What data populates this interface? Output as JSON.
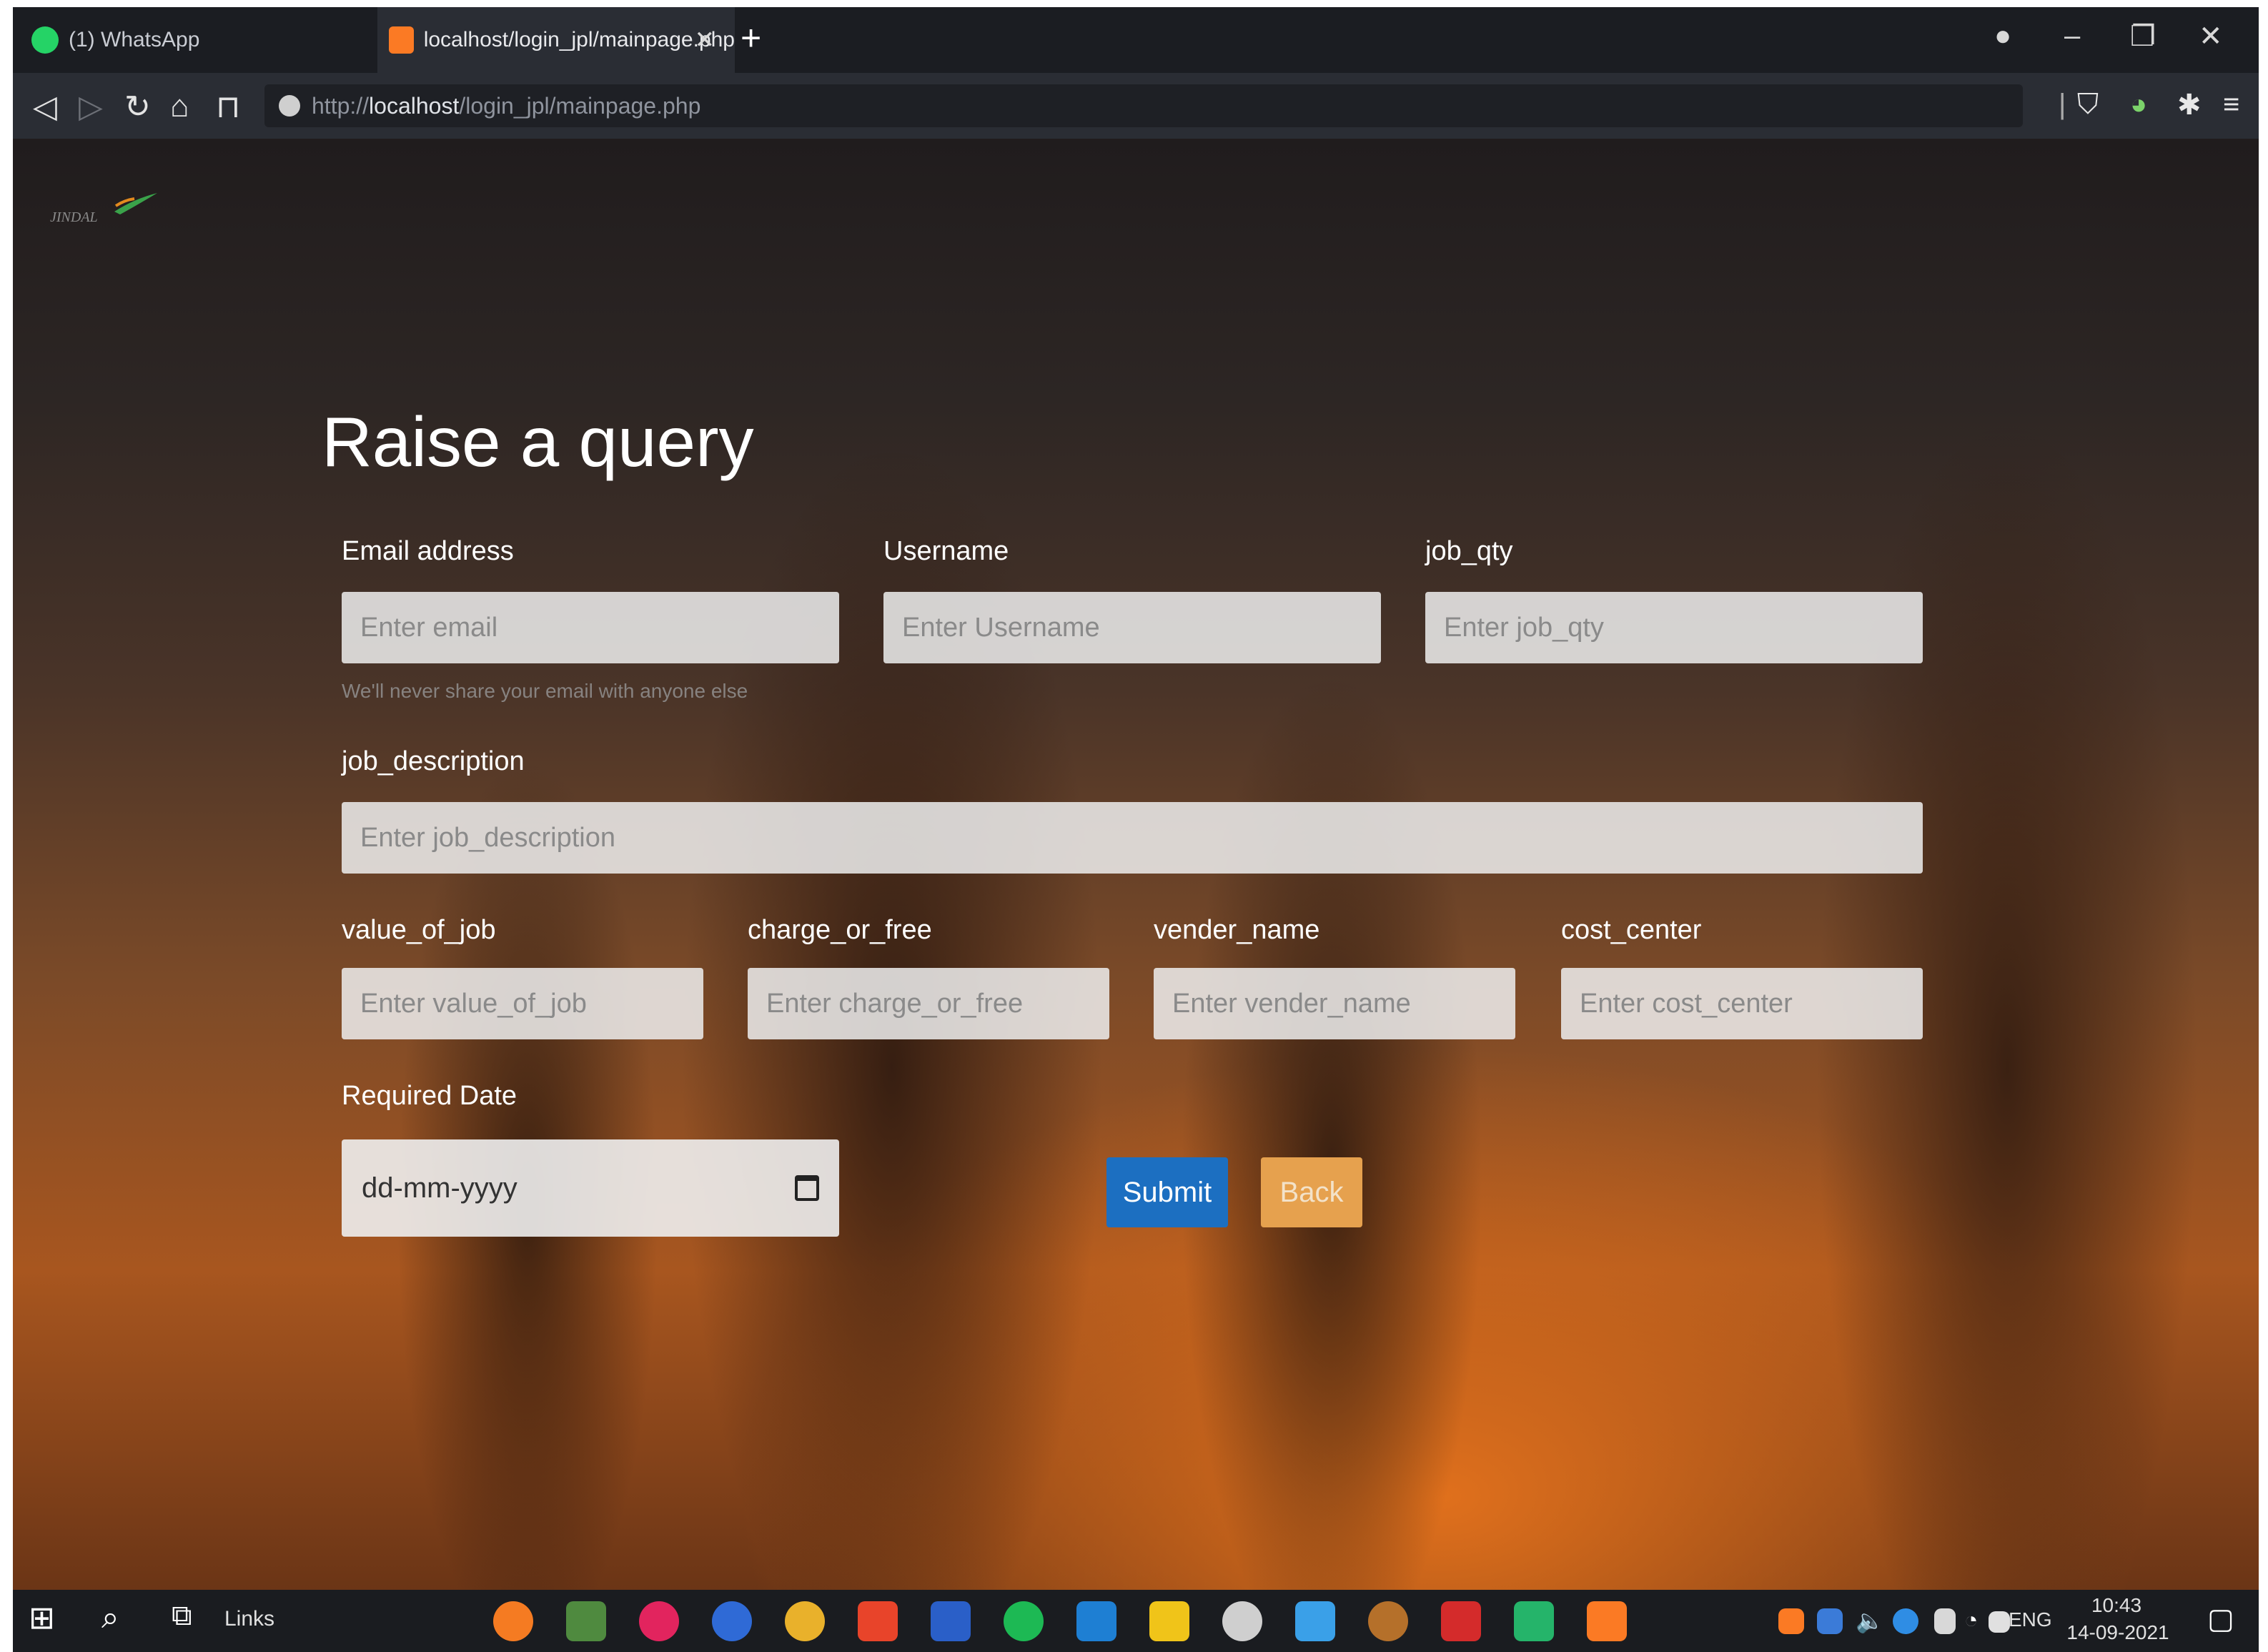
{
  "browser": {
    "tabs": [
      {
        "label": "(1) WhatsApp"
      },
      {
        "label": "localhost/login_jpl/mainpage.php"
      }
    ],
    "tab_close": "✕",
    "new_tab": "+",
    "url_prefix": "http://",
    "url_host": "localhost",
    "url_path": "/login_jpl/mainpage.php"
  },
  "page": {
    "logo_text": "JINDAL",
    "title": "Raise a query",
    "fields": {
      "email": {
        "label": "Email address",
        "placeholder": "Enter email",
        "help": "We'll never share your email with anyone else"
      },
      "username": {
        "label": "Username",
        "placeholder": "Enter Username"
      },
      "job_qty": {
        "label": "job_qty",
        "placeholder": "Enter job_qty"
      },
      "job_description": {
        "label": "job_description",
        "placeholder": "Enter job_description"
      },
      "value_of_job": {
        "label": "value_of_job",
        "placeholder": "Enter value_of_job"
      },
      "charge_or_free": {
        "label": "charge_or_free",
        "placeholder": "Enter charge_or_free"
      },
      "vender_name": {
        "label": "vender_name",
        "placeholder": "Enter vender_name"
      },
      "cost_center": {
        "label": "cost_center",
        "placeholder": "Enter cost_center"
      },
      "required_date": {
        "label": "Required Date",
        "placeholder": "dd-mm-yyyy"
      }
    },
    "buttons": {
      "submit": "Submit",
      "back": "Back"
    }
  },
  "taskbar": {
    "links": "Links",
    "language": "ENG",
    "time": "10:43",
    "date": "14-09-2021"
  }
}
